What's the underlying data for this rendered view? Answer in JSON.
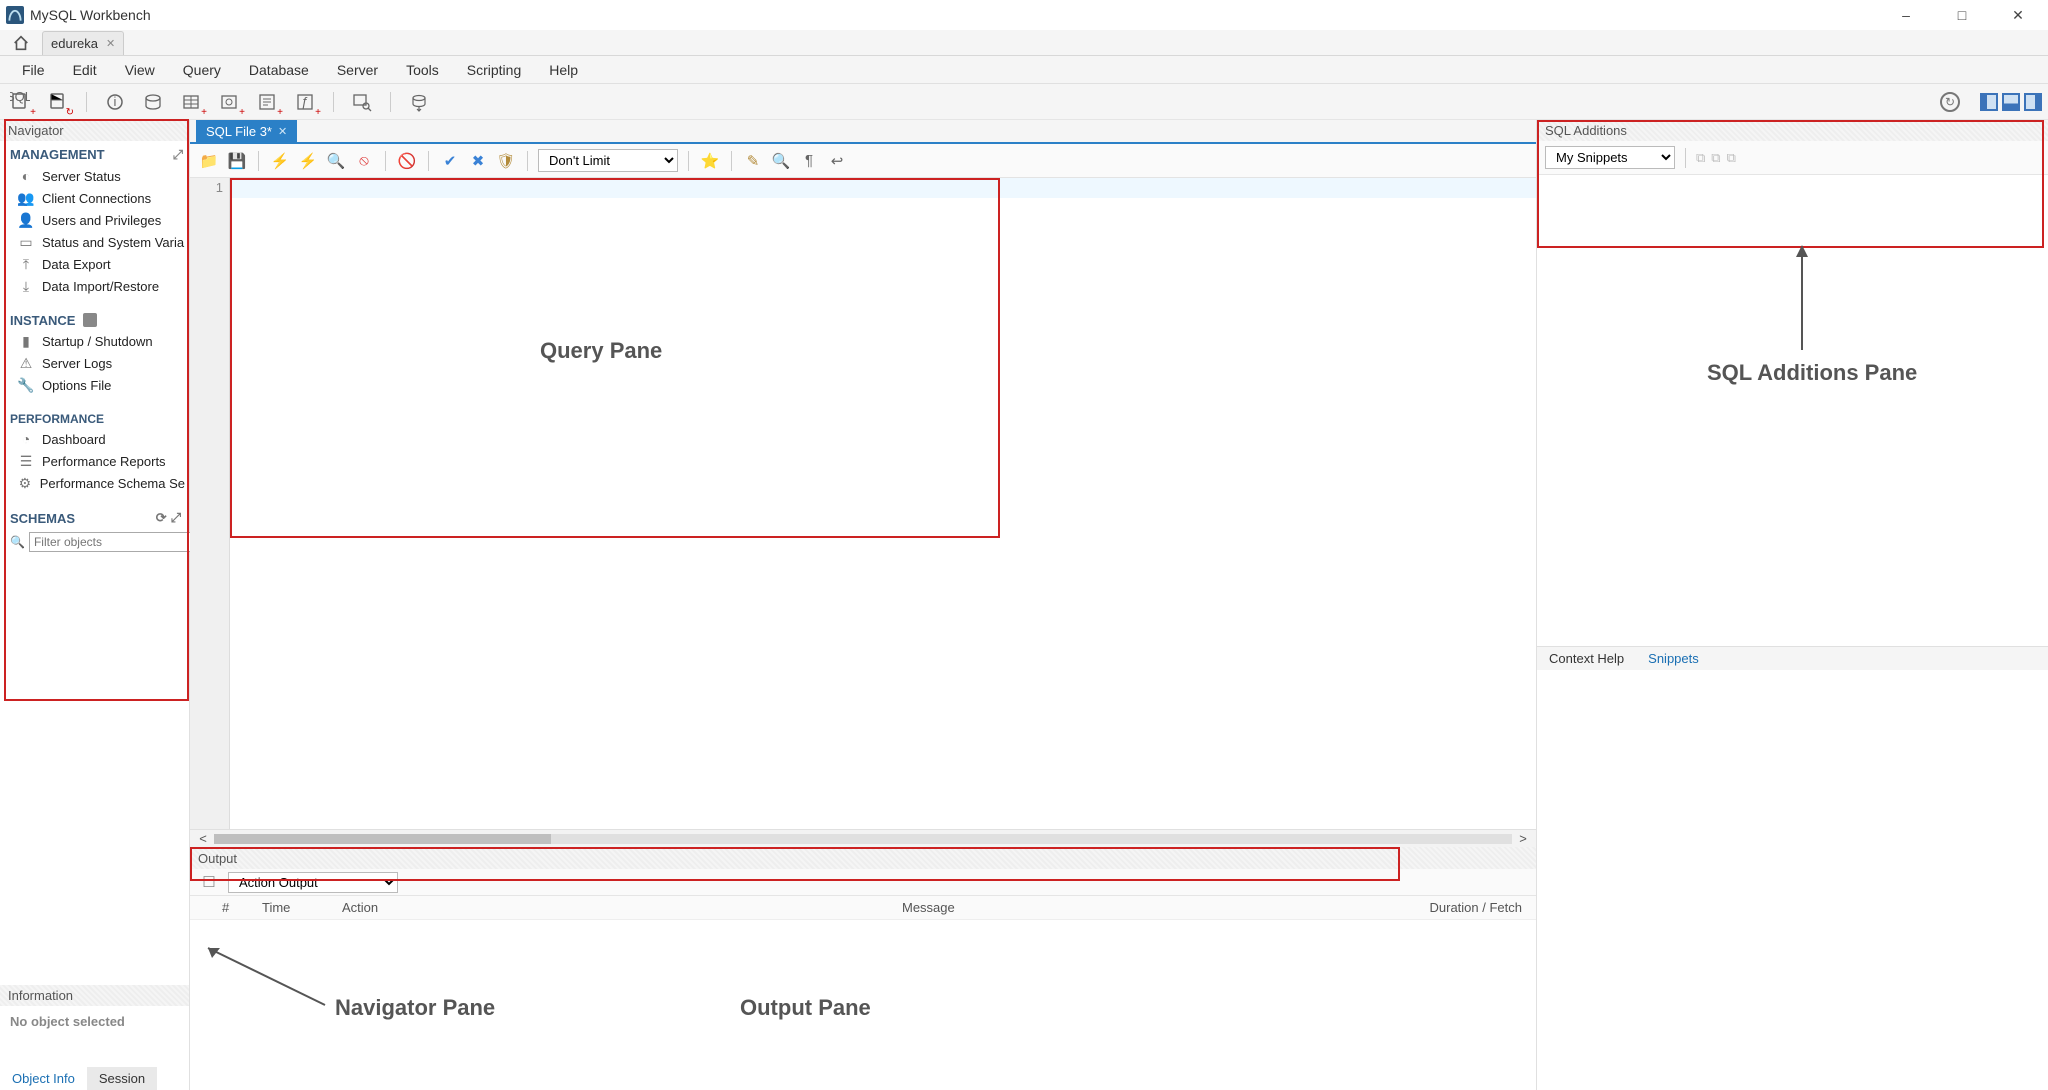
{
  "window_title": "MySQL Workbench",
  "connection_tab": "edureka",
  "menu": [
    "File",
    "Edit",
    "View",
    "Query",
    "Database",
    "Server",
    "Tools",
    "Scripting",
    "Help"
  ],
  "navigator": {
    "title": "Navigator",
    "management_label": "MANAGEMENT",
    "management": [
      {
        "icon": "gauge",
        "label": "Server Status"
      },
      {
        "icon": "people",
        "label": "Client Connections"
      },
      {
        "icon": "user",
        "label": "Users and Privileges"
      },
      {
        "icon": "monitor",
        "label": "Status and System Varia"
      },
      {
        "icon": "export",
        "label": "Data Export"
      },
      {
        "icon": "import",
        "label": "Data Import/Restore"
      }
    ],
    "instance_label": "INSTANCE",
    "instance": [
      {
        "icon": "power",
        "label": "Startup / Shutdown"
      },
      {
        "icon": "warn",
        "label": "Server Logs"
      },
      {
        "icon": "wrench",
        "label": "Options File"
      }
    ],
    "performance_label": "PERFORMANCE",
    "performance": [
      {
        "icon": "dash",
        "label": "Dashboard"
      },
      {
        "icon": "report",
        "label": "Performance Reports"
      },
      {
        "icon": "schema",
        "label": "Performance Schema Se"
      }
    ],
    "schemas_label": "SCHEMAS",
    "filter_placeholder": "Filter objects",
    "info_label": "Information",
    "no_object": "No object selected",
    "info_tabs": [
      "Object Info",
      "Session"
    ]
  },
  "sql_tab": "SQL File 3*",
  "limit_select": "Don't Limit",
  "line_number": "1",
  "output": {
    "title": "Output",
    "select_label": "Action Output",
    "cols": {
      "n": "#",
      "time": "Time",
      "action": "Action",
      "message": "Message",
      "duration": "Duration / Fetch"
    }
  },
  "additions": {
    "title": "SQL Additions",
    "snippets_select": "My Snippets",
    "tabs": [
      "Context Help",
      "Snippets"
    ]
  },
  "annotations": {
    "query_pane": "Query Pane",
    "sql_additions_pane": "SQL Additions Pane",
    "navigator_pane": "Navigator Pane",
    "output_pane": "Output Pane"
  }
}
